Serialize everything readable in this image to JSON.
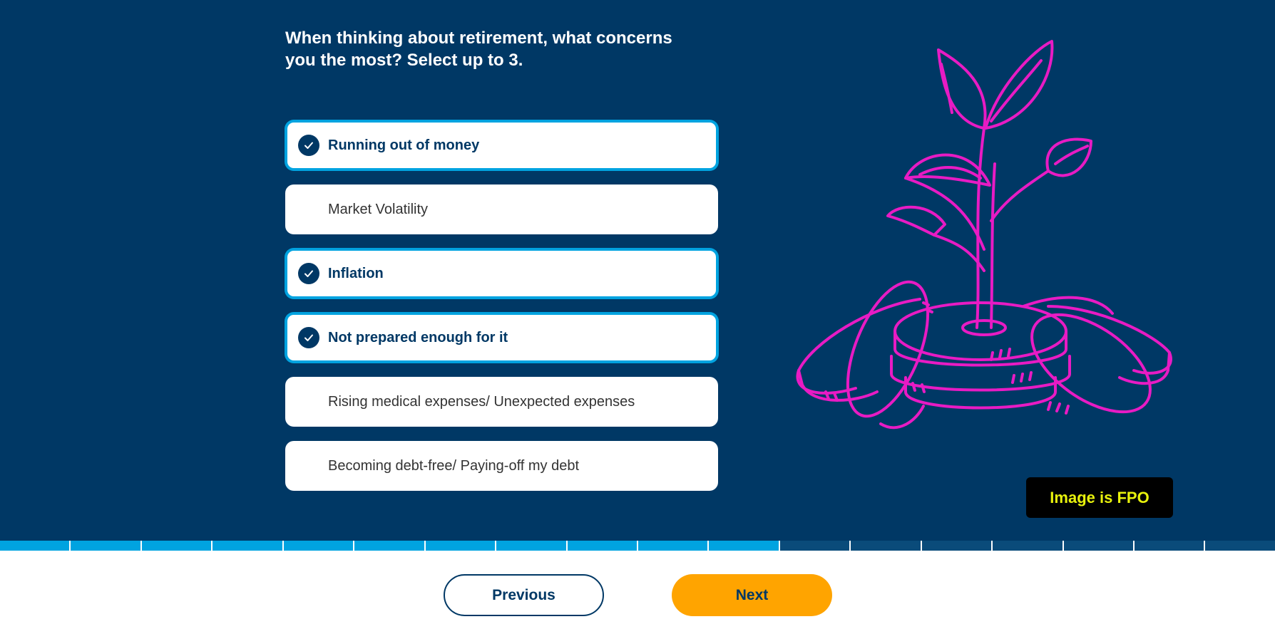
{
  "question": {
    "line1": "When thinking about retirement, what concerns",
    "line2": "you the most? Select up to 3."
  },
  "options": [
    {
      "label": "Running out of money",
      "selected": true
    },
    {
      "label": "Market Volatility",
      "selected": false
    },
    {
      "label": "Inflation",
      "selected": true
    },
    {
      "label": "Not prepared enough for it",
      "selected": true
    },
    {
      "label": "Rising medical expenses/ Unexpected expenses",
      "selected": false
    },
    {
      "label": "Becoming debt-free/ Paying-off my debt",
      "selected": false
    }
  ],
  "fpo_badge": "Image is FPO",
  "progress": {
    "completed": 11,
    "total": 18
  },
  "buttons": {
    "previous": "Previous",
    "next": "Next"
  },
  "colors": {
    "background": "#003865",
    "accent": "#00a3e0",
    "next_button": "#ffa400",
    "illustration": "#e81bc4",
    "fpo_text": "#e8f20c"
  },
  "icons": {
    "check": "checkmark-icon",
    "illustration": "plant-coins-illustration"
  }
}
